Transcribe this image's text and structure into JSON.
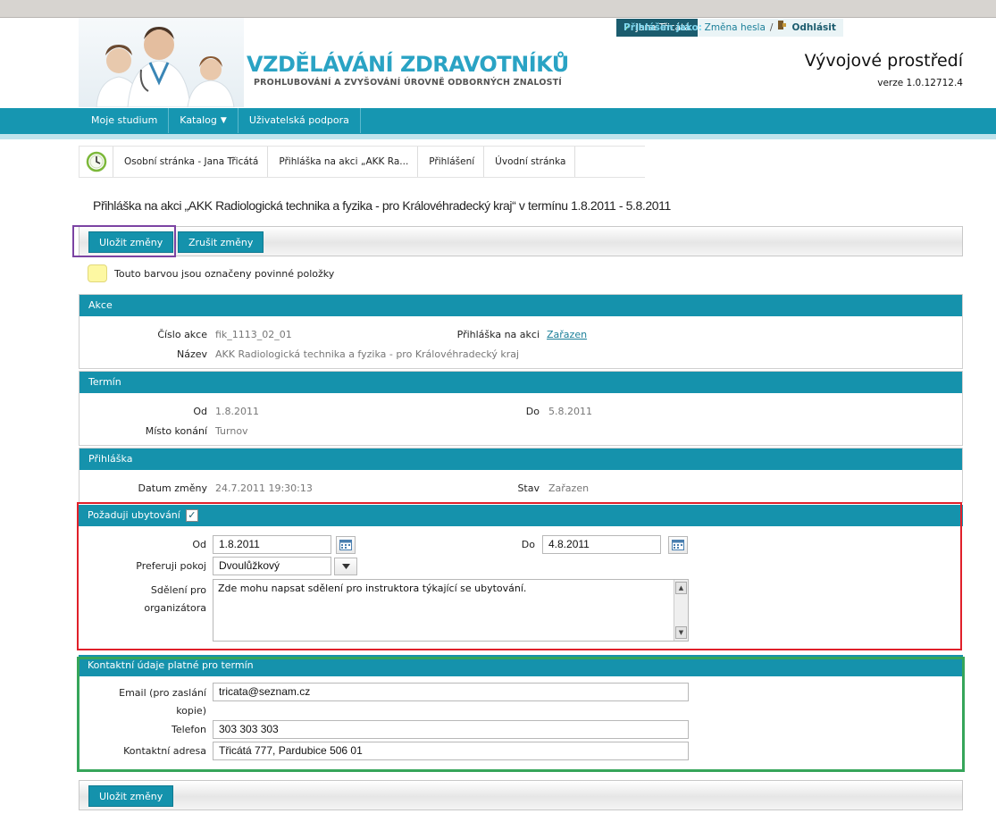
{
  "header": {
    "brand_part1": "VZDĚLÁVÁNÍ",
    "brand_part2": "ZDRAVOTNÍKŮ",
    "tagline": "PROHLUBOVÁNÍ A ZVYŠOVÁNÍ ÚROVNĚ ODBORNÝCH ZNALOSTÍ",
    "logged_label": "Přihlášen jako:",
    "user_name": "Jana Třicátá",
    "change_password": "Změna hesla",
    "separator": "/",
    "logout": "Odhlásit",
    "environment": "Vývojové prostředí",
    "version": "verze 1.0.12712.4"
  },
  "nav": {
    "items": [
      "Moje studium",
      "Katalog",
      "Uživatelská podpora"
    ]
  },
  "breadcrumb": {
    "items": [
      "Osobní stránka - Jana Třicátá",
      "Přihláška na akci „AKK Ra...",
      "Přihlášení",
      "Úvodní stránka"
    ]
  },
  "page_title": "Přihláška na akci „AKK Radiologická technika a fyzika - pro Královéhradecký kraj“ v termínu 1.8.2011 - 5.8.2011",
  "toolbar": {
    "save": "Uložit změny",
    "cancel": "Zrušit změny"
  },
  "required_note": "Touto barvou jsou označeny povinné položky",
  "akce": {
    "title": "Akce",
    "cislo_label": "Číslo akce",
    "cislo_value": "fik_1113_02_01",
    "prihlaska_label": "Přihláška na akci",
    "prihlaska_value": "Zařazen",
    "nazev_label": "Název",
    "nazev_value": "AKK Radiologická technika a fyzika - pro Královéhradecký kraj"
  },
  "termin": {
    "title": "Termín",
    "od_label": "Od",
    "od_value": "1.8.2011",
    "do_label": "Do",
    "do_value": "5.8.2011",
    "misto_label": "Místo konání",
    "misto_value": "Turnov"
  },
  "prihlaska": {
    "title": "Přihláška",
    "datum_label": "Datum změny",
    "datum_value": "24.7.2011 19:30:13",
    "stav_label": "Stav",
    "stav_value": "Zařazen"
  },
  "ubytovani": {
    "title": "Požaduji ubytování",
    "checked": true,
    "od_label": "Od",
    "od_value": "1.8.2011",
    "do_label": "Do",
    "do_value": "4.8.2011",
    "pokoj_label": "Preferuji pokoj",
    "pokoj_value": "Dvoulůžkový",
    "sdeleni_label_1": "Sdělení pro",
    "sdeleni_label_2": "organizátora",
    "sdeleni_value": "Zde mohu napsat sdělení pro instruktora týkající se ubytování."
  },
  "kontakt": {
    "title": "Kontaktní údaje platné pro termín",
    "email_label_1": "Email (pro zaslání",
    "email_label_2": "kopie)",
    "email_value": "tricata@seznam.cz",
    "telefon_label": "Telefon",
    "telefon_value": "303 303 303",
    "adresa_label": "Kontaktní adresa",
    "adresa_value": "Třicátá 777, Pardubice 506 01"
  },
  "colors": {
    "accent": "#1592ac",
    "required": "#fdf8a2",
    "highlight_purple": "#7b43a3",
    "highlight_red": "#e0202a",
    "highlight_green": "#36a55a"
  }
}
